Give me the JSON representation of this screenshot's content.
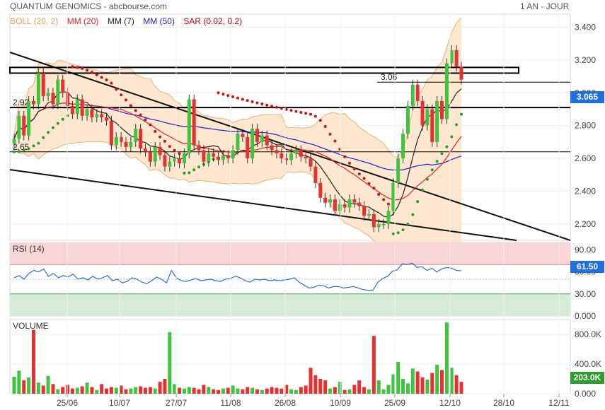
{
  "header": {
    "title": "QUANTUM GENOMICS - abcbourse.com",
    "period": "1 AN - JOUR"
  },
  "legend": [
    {
      "label": "BOLL (20, 2)",
      "color": "#f0a860"
    },
    {
      "label": "MM (20)",
      "color": "#e82020"
    },
    {
      "label": "MM (7)",
      "color": "#222222"
    },
    {
      "label": "MM (50)",
      "color": "#2020d0"
    },
    {
      "label": "SAR (0.02, 0.2)",
      "color": "#c00000"
    }
  ],
  "colors": {
    "up": "#3ec43e",
    "down": "#e83030",
    "boll_fill": "#fde3c6",
    "rsi_high": "#f9d6d6",
    "rsi_low": "#d6ecd6",
    "rsi_line": "#2a6fd0",
    "sar_dots": "#d01010",
    "sar_green": "#22a022",
    "badge_price": "#1f6fe0",
    "badge_rsi": "#1f6fe0",
    "badge_vol": "#2aa02a"
  },
  "chart_data": [
    {
      "type": "candlestick",
      "title": "QUANTUM GENOMICS",
      "x_tick_labels": [
        "25/06",
        "10/07",
        "27/07",
        "11/08",
        "26/08",
        "10/09",
        "25/09",
        "12/10",
        "28/10",
        "12/11"
      ],
      "y_ticks": [
        2.2,
        2.4,
        2.6,
        2.8,
        3.0,
        3.2,
        3.4
      ],
      "y_tick_labels": [
        "2.200",
        "2.400",
        "2.600",
        "2.800",
        "3.000",
        "3.200",
        "3.400"
      ],
      "ylim": [
        2.1,
        3.48
      ],
      "last_price": "3.065",
      "level_labels": [
        "3.06",
        "2.92",
        "2.65"
      ],
      "horizontal_levels": [
        3.065,
        2.91,
        2.64
      ],
      "resistance_box": [
        3.12,
        3.155
      ],
      "close": [
        2.72,
        2.86,
        2.74,
        2.95,
        2.93,
        3.12,
        2.98,
        3.0,
        2.93,
        3.08,
        3.0,
        2.92,
        2.87,
        2.96,
        2.86,
        2.9,
        2.85,
        2.87,
        2.85,
        2.83,
        2.68,
        2.73,
        2.7,
        2.67,
        2.7,
        2.78,
        2.66,
        2.64,
        2.58,
        2.67,
        2.62,
        2.55,
        2.58,
        2.6,
        2.57,
        2.63,
        2.96,
        2.68,
        2.65,
        2.58,
        2.63,
        2.61,
        2.59,
        2.62,
        2.6,
        2.65,
        2.75,
        2.73,
        2.6,
        2.78,
        2.7,
        2.74,
        2.68,
        2.65,
        2.63,
        2.6,
        2.59,
        2.63,
        2.65,
        2.61,
        2.6,
        2.55,
        2.45,
        2.36,
        2.33,
        2.35,
        2.28,
        2.32,
        2.3,
        2.35,
        2.33,
        2.31,
        2.25,
        2.26,
        2.18,
        2.2,
        2.2,
        2.28,
        2.45,
        2.6,
        2.75,
        2.92,
        3.05,
        2.95,
        2.8,
        2.9,
        2.7,
        2.95,
        2.84,
        3.18,
        3.26,
        3.16,
        3.08
      ],
      "volume_y_ticks": [
        0,
        400000,
        800000
      ],
      "volume_y_tick_labels": [
        "0.000",
        "400.0K",
        "800.0K"
      ],
      "volume_last": "203.0K",
      "volume_ylim": [
        0,
        1000000
      ],
      "volume": [
        230,
        310,
        180,
        220,
        860,
        150,
        110,
        240,
        130,
        60,
        90,
        120,
        70,
        80,
        100,
        150,
        90,
        50,
        130,
        70,
        90,
        80,
        110,
        60,
        70,
        90,
        100,
        80,
        90,
        70,
        160,
        200,
        830,
        130,
        80,
        70,
        90,
        80,
        60,
        120,
        90,
        60,
        50,
        70,
        80,
        110,
        70,
        60,
        90,
        80,
        60,
        50,
        70,
        90,
        80,
        70,
        120,
        60,
        50,
        90,
        110,
        350,
        250,
        200,
        180,
        70,
        90,
        160,
        50,
        60,
        120,
        180,
        90,
        60,
        780,
        180,
        60,
        120,
        260,
        430,
        200,
        140,
        340,
        300,
        220,
        190,
        280,
        390,
        320,
        960,
        350,
        250,
        160
      ]
    },
    {
      "type": "line",
      "title": "RSI (14)",
      "y_ticks": [
        0,
        30,
        60,
        90
      ],
      "y_tick_labels": [
        "0.000",
        "30.00",
        "60.00",
        "90.00"
      ],
      "ylim": [
        0,
        100
      ],
      "zones": {
        "overbought": 70,
        "oversold": 30
      },
      "last_value": "61.50",
      "values": [
        52,
        55,
        50,
        58,
        62,
        60,
        64,
        54,
        58,
        52,
        55,
        53,
        57,
        50,
        52,
        49,
        54,
        50,
        52,
        55,
        48,
        50,
        45,
        47,
        52,
        50,
        46,
        44,
        48,
        53,
        50,
        45,
        62,
        52,
        48,
        47,
        49,
        51,
        48,
        49,
        50,
        48,
        47,
        50,
        51,
        54,
        52,
        48,
        46,
        50,
        49,
        50,
        48,
        49,
        48,
        49,
        50,
        52,
        46,
        42,
        38,
        39,
        42,
        41,
        38,
        40,
        40,
        38,
        39,
        40,
        38,
        36,
        35,
        35,
        46,
        51,
        54,
        61,
        63,
        71,
        70,
        72,
        66,
        67,
        62,
        65,
        60,
        64,
        66,
        65,
        62,
        61.5
      ]
    }
  ]
}
